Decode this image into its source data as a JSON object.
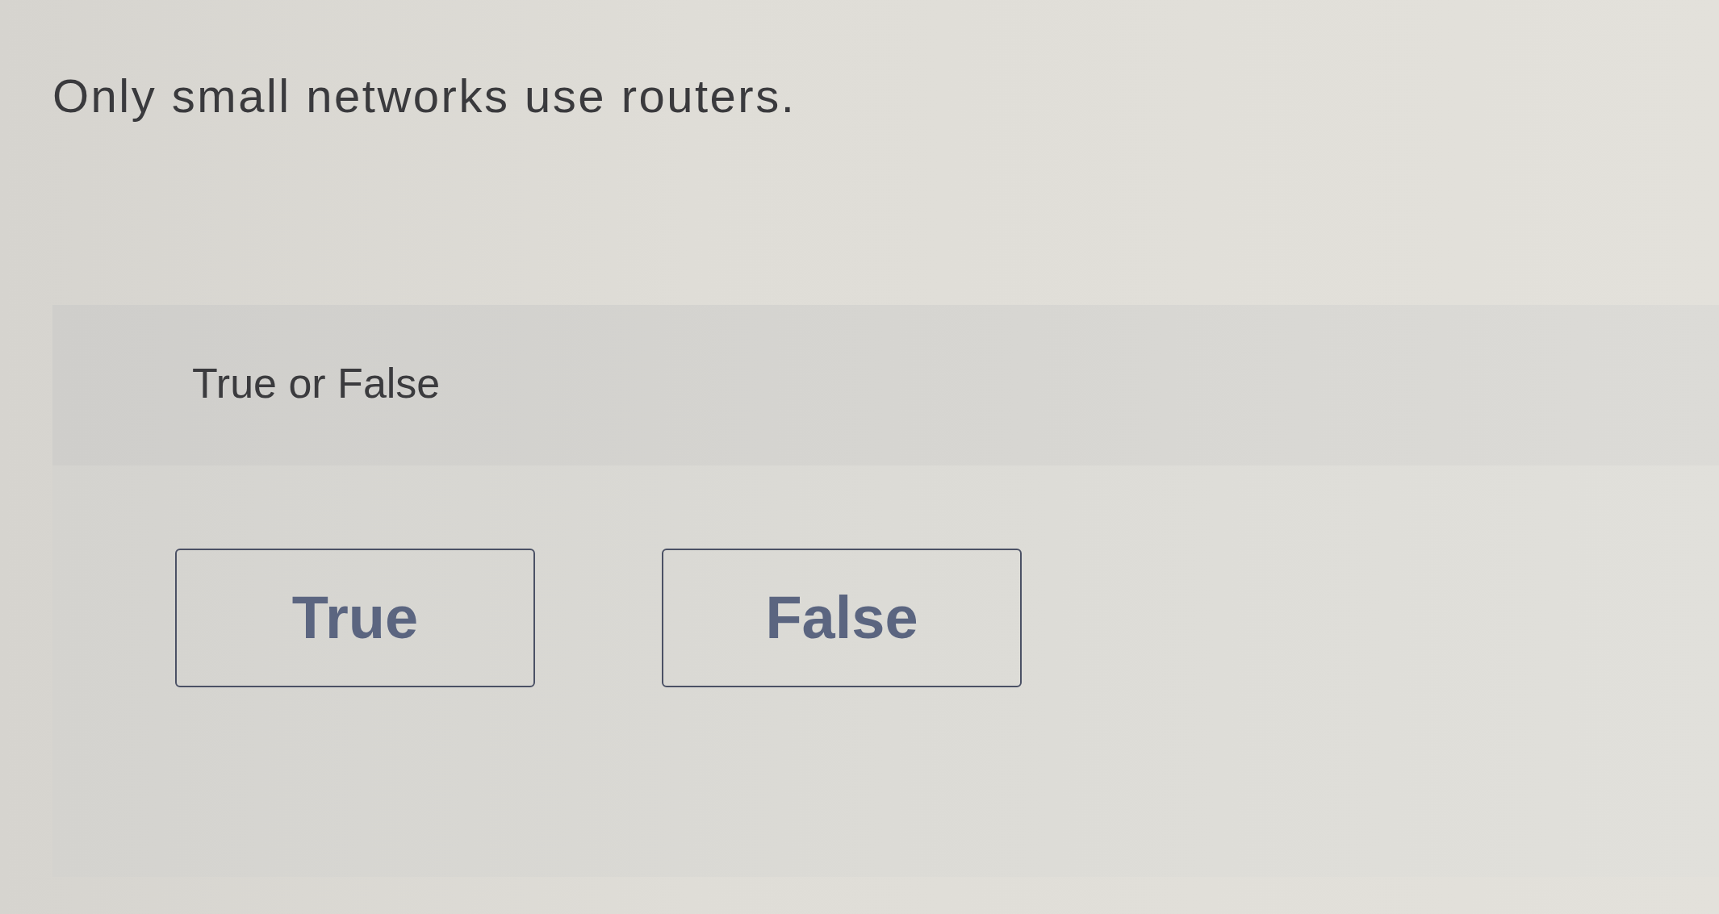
{
  "question": {
    "text": "Only small networks use routers."
  },
  "answer_panel": {
    "label": "True or False",
    "options": [
      {
        "label": "True"
      },
      {
        "label": "False"
      }
    ]
  }
}
